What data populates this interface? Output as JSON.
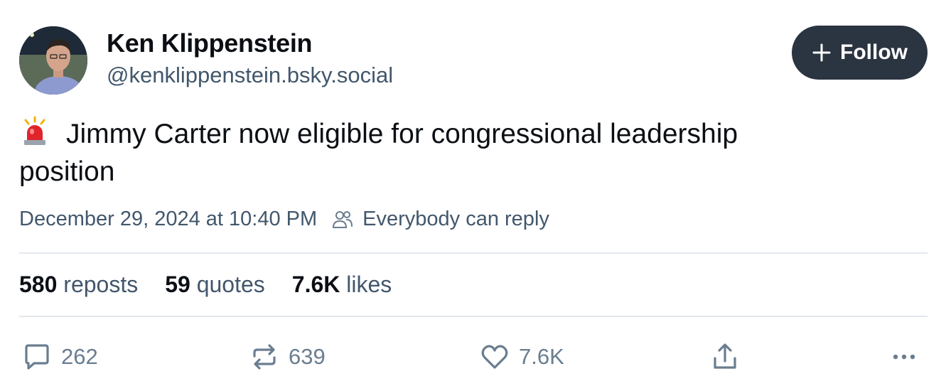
{
  "author": {
    "display_name": "Ken Klippenstein",
    "handle": "@kenklippenstein.bsky.social",
    "avatar_icon": "avatar-photo"
  },
  "follow_button": {
    "label": "Follow",
    "icon": "plus-icon"
  },
  "post": {
    "emoji_icon": "police-car-light-icon",
    "text_line1": "Jimmy Carter now eligible for congressional leadership",
    "text_line2": "position"
  },
  "meta": {
    "timestamp": "December 29, 2024 at 10:40 PM",
    "reply_setting": "Everybody can reply",
    "reply_icon": "people-icon"
  },
  "stats": [
    {
      "count": "580",
      "label": "reposts"
    },
    {
      "count": "59",
      "label": "quotes"
    },
    {
      "count": "7.6K",
      "label": "likes"
    }
  ],
  "actions": {
    "reply": {
      "icon": "comment-icon",
      "count": "262"
    },
    "repost": {
      "icon": "repost-icon",
      "count": "639"
    },
    "like": {
      "icon": "heart-icon",
      "count": "7.6K"
    },
    "share": {
      "icon": "share-icon"
    },
    "more": {
      "icon": "more-icon"
    }
  },
  "colors": {
    "text": "#0b0f14",
    "muted": "#42576c",
    "action": "#6a7d90",
    "follow_bg": "#2b3441",
    "divider": "#e3e8ed"
  }
}
